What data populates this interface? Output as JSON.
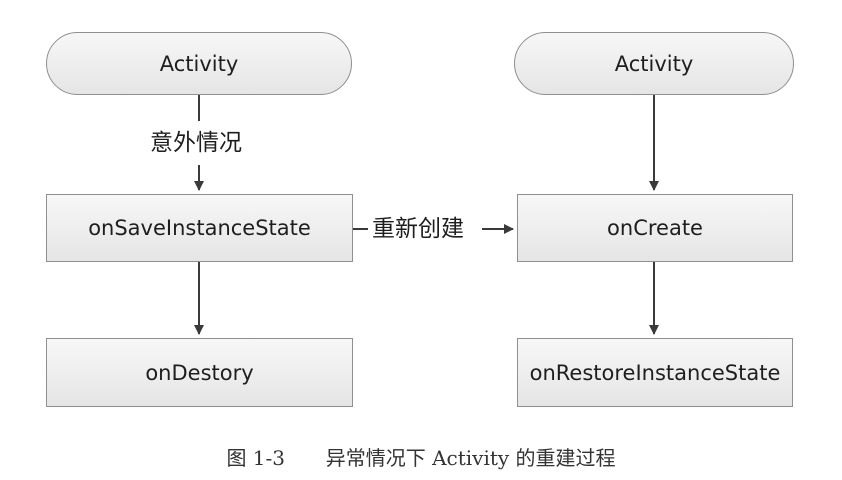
{
  "nodes": {
    "left_start": "Activity",
    "save_state": "onSaveInstanceState",
    "destroy": "onDestory",
    "right_start": "Activity",
    "create": "onCreate",
    "restore_state": "onRestoreInstanceState"
  },
  "edges": {
    "unexpected": "意外情况",
    "recreate": "重新创建"
  },
  "caption": {
    "number": "图 1-3",
    "text": "异常情况下 Activity 的重建过程"
  }
}
